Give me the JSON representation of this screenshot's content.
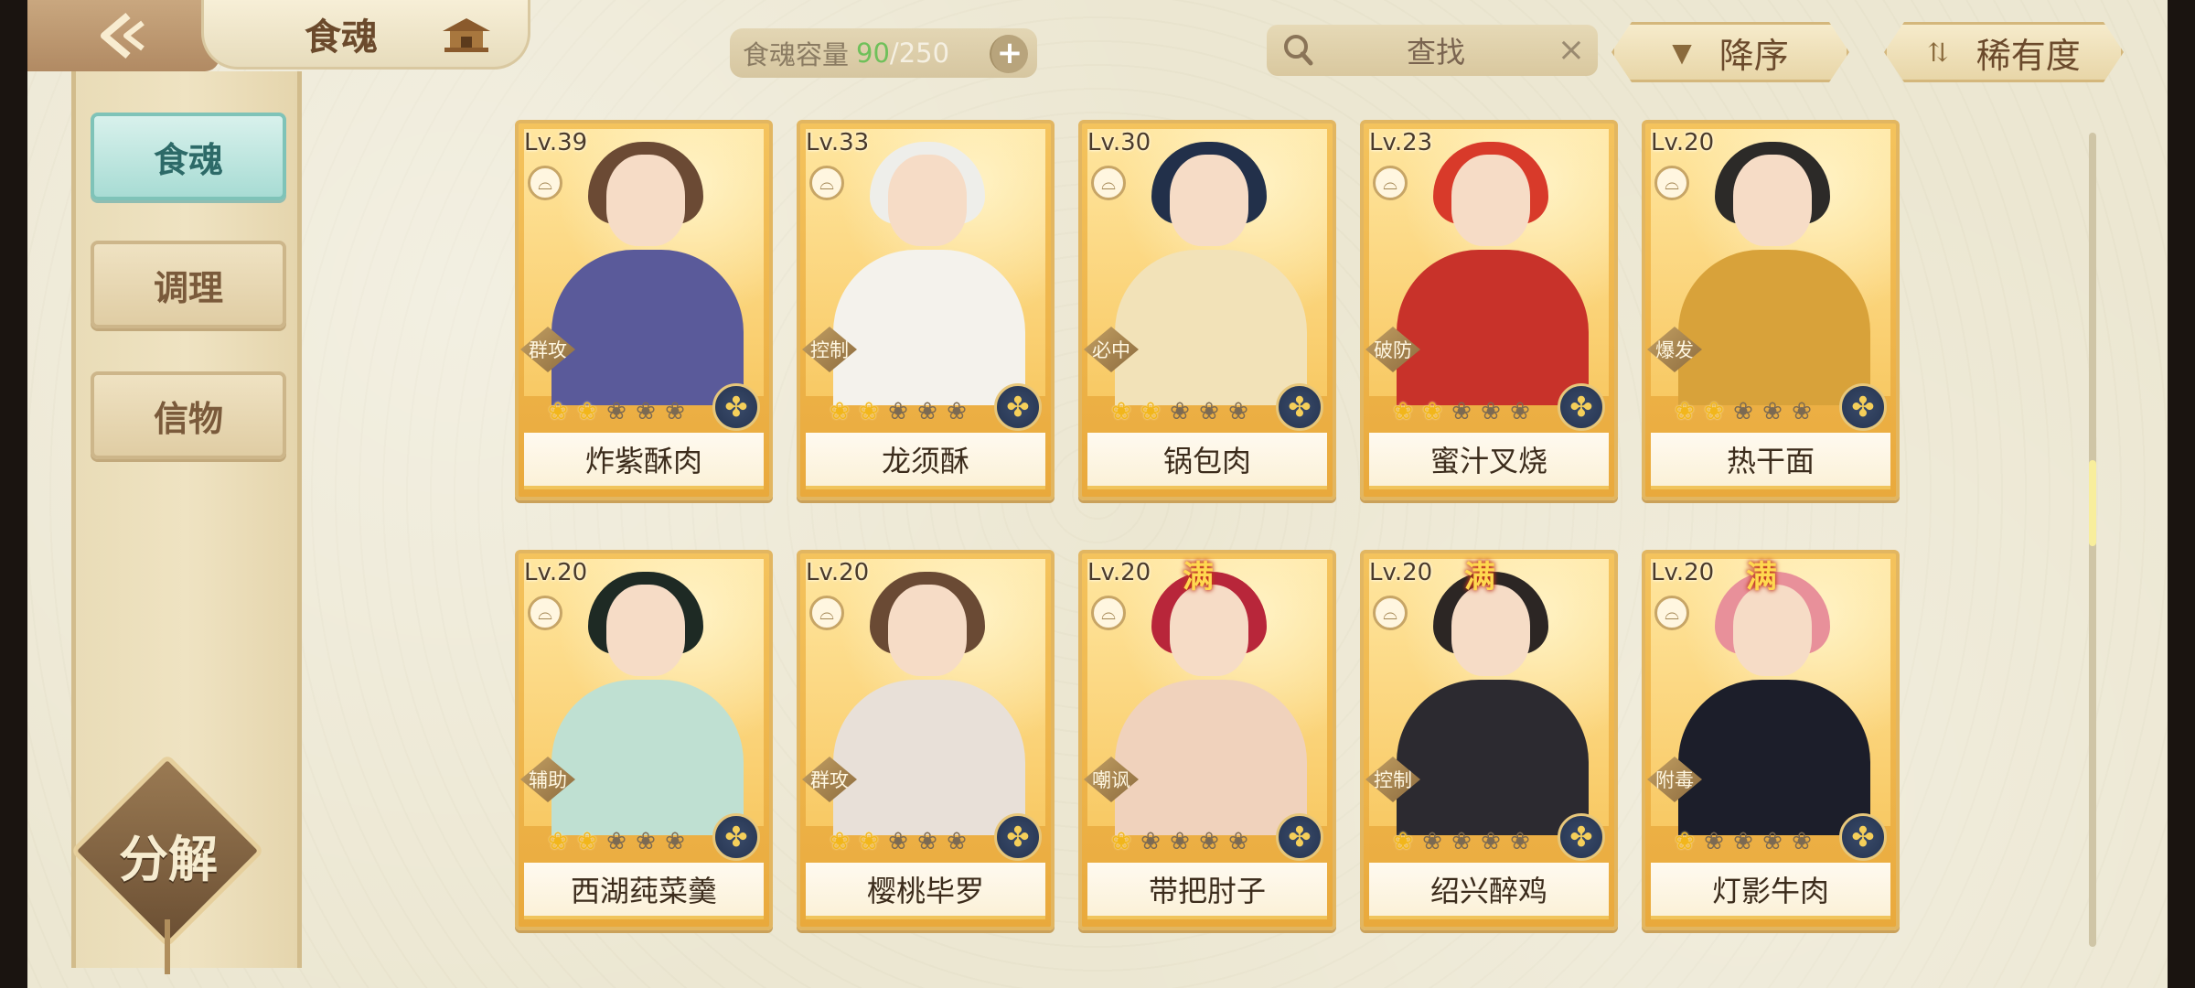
{
  "header": {
    "title": "食魂",
    "capacity_label": "食魂容量",
    "capacity_current": "90",
    "capacity_max": "/250",
    "search_label": "查找",
    "sort_label": "降序",
    "rarity_label": "稀有度"
  },
  "sidebar": {
    "items": [
      {
        "label": "食魂",
        "active": true
      },
      {
        "label": "调理",
        "active": false
      },
      {
        "label": "信物",
        "active": false
      }
    ],
    "decompose_label": "分解"
  },
  "scroll_position": 0.45,
  "colors": {
    "card_gold": "#f4c35d",
    "active_tab": "#a8dcd4",
    "capacity_green": "#6fc05a"
  },
  "cards": [
    {
      "level": "Lv.39",
      "name": "炸紫酥肉",
      "role": "群攻",
      "stars_lit": 2,
      "stars_total": 5,
      "full": "",
      "hair": "#6b4a34",
      "outfit": "#5a5a9a"
    },
    {
      "level": "Lv.33",
      "name": "龙须酥",
      "role": "控制",
      "stars_lit": 2,
      "stars_total": 5,
      "full": "",
      "hair": "#eeeeea",
      "outfit": "#f4f2ec"
    },
    {
      "level": "Lv.30",
      "name": "锅包肉",
      "role": "必中",
      "stars_lit": 2,
      "stars_total": 5,
      "full": "",
      "hair": "#22304a",
      "outfit": "#f2e2b8"
    },
    {
      "level": "Lv.23",
      "name": "蜜汁叉烧",
      "role": "破防",
      "stars_lit": 2,
      "stars_total": 5,
      "full": "",
      "hair": "#d83a2a",
      "outfit": "#c8322a"
    },
    {
      "level": "Lv.20",
      "name": "热干面",
      "role": "爆发",
      "stars_lit": 2,
      "stars_total": 5,
      "full": "",
      "hair": "#2c2a28",
      "outfit": "#d8a23a"
    },
    {
      "level": "Lv.20",
      "name": "西湖莼菜羹",
      "role": "辅助",
      "stars_lit": 2,
      "stars_total": 5,
      "full": "",
      "hair": "#1e2a24",
      "outfit": "#bfe0d2"
    },
    {
      "level": "Lv.20",
      "name": "樱桃毕罗",
      "role": "群攻",
      "stars_lit": 2,
      "stars_total": 5,
      "full": "",
      "hair": "#6a4a34",
      "outfit": "#e8e0d8"
    },
    {
      "level": "Lv.20",
      "name": "带把肘子",
      "role": "嘲讽",
      "stars_lit": 1,
      "stars_total": 5,
      "full": "满",
      "hair": "#b8263a",
      "outfit": "#f0d2bc"
    },
    {
      "level": "Lv.20",
      "name": "绍兴醉鸡",
      "role": "控制",
      "stars_lit": 1,
      "stars_total": 5,
      "full": "满",
      "hair": "#2c2624",
      "outfit": "#2c2a30"
    },
    {
      "level": "Lv.20",
      "name": "灯影牛肉",
      "role": "附毒",
      "stars_lit": 1,
      "stars_total": 5,
      "full": "满",
      "hair": "#e8909a",
      "outfit": "#1c1e2a"
    }
  ]
}
